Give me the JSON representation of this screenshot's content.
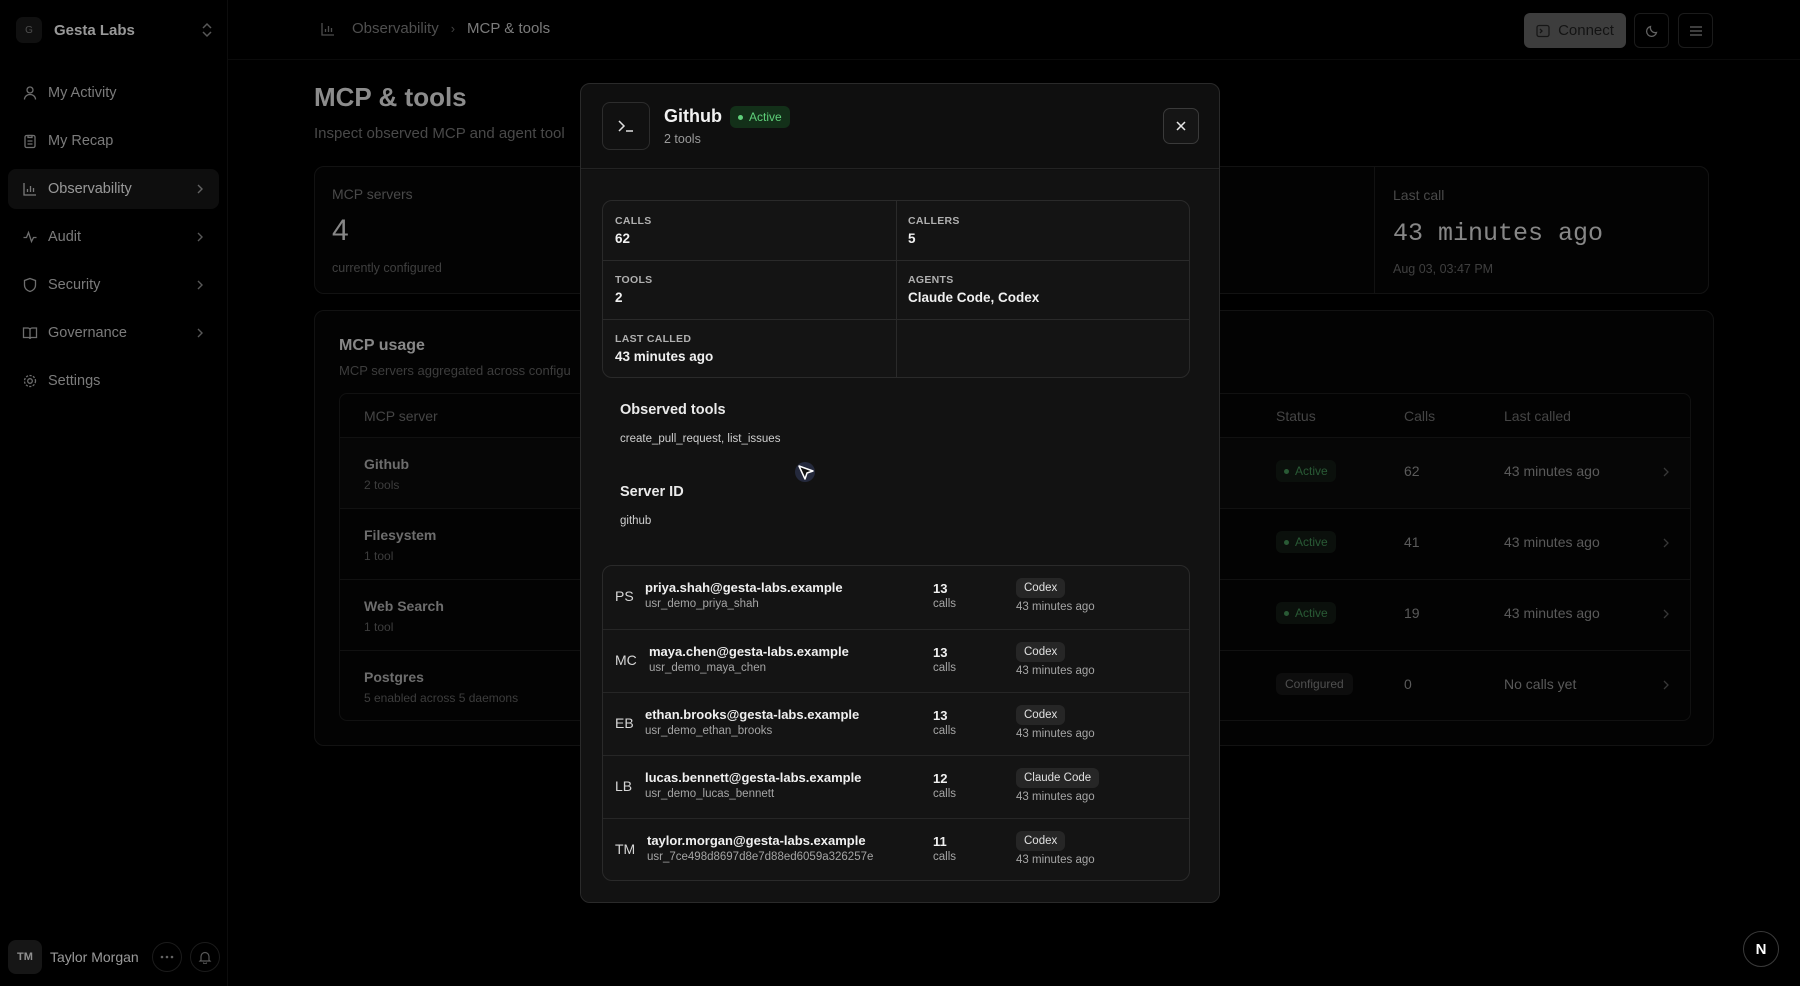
{
  "sidebar": {
    "org_initial": "G",
    "org_name": "Gesta Labs",
    "items": [
      {
        "label": "My Activity",
        "icon": "user-icon"
      },
      {
        "label": "My Recap",
        "icon": "clipboard-icon"
      },
      {
        "label": "Observability",
        "icon": "bar-chart-icon"
      },
      {
        "label": "Audit",
        "icon": "activity-icon"
      },
      {
        "label": "Security",
        "icon": "shield-icon"
      },
      {
        "label": "Governance",
        "icon": "book-icon"
      },
      {
        "label": "Settings",
        "icon": "gear-icon"
      }
    ],
    "user_initials": "TM",
    "user_name": "Taylor Morgan"
  },
  "topbar": {
    "breadcrumb_parent": "Observability",
    "breadcrumb_current": "MCP & tools",
    "connect_label": "Connect"
  },
  "page": {
    "title": "MCP & tools",
    "subtitle": "Inspect observed MCP and agent tool",
    "stats": [
      {
        "label": "MCP servers",
        "value": "4",
        "note": "currently configured"
      },
      {
        "label": "Last call",
        "value": "43 minutes ago",
        "note": "Aug 03, 03:47 PM"
      }
    ],
    "usage": {
      "title": "MCP usage",
      "subtitle": "MCP servers aggregated across configu",
      "headers": {
        "server": "MCP server",
        "status": "Status",
        "calls": "Calls",
        "last_called": "Last called"
      },
      "rows": [
        {
          "name": "Github",
          "sub": "2 tools",
          "status": "Active",
          "calls": "62",
          "last": "43 minutes ago"
        },
        {
          "name": "Filesystem",
          "sub": "1 tool",
          "status": "Active",
          "calls": "41",
          "last": "43 minutes ago"
        },
        {
          "name": "Web Search",
          "sub": "1 tool",
          "status": "Active",
          "calls": "19",
          "last": "43 minutes ago"
        },
        {
          "name": "Postgres",
          "sub": "5 enabled across 5 daemons",
          "status": "Configured",
          "calls": "0",
          "last": "No calls yet"
        }
      ]
    }
  },
  "modal": {
    "title": "Github",
    "status": "Active",
    "subtitle": "2 tools",
    "stats": {
      "calls_label": "CALLS",
      "calls": "62",
      "callers_label": "CALLERS",
      "callers": "5",
      "tools_label": "TOOLS",
      "tools": "2",
      "agents_label": "AGENTS",
      "agents": "Claude Code, Codex",
      "last_called_label": "LAST CALLED",
      "last_called": "43 minutes ago"
    },
    "observed_tools_title": "Observed tools",
    "observed_tools": "create_pull_request, list_issues",
    "server_id_title": "Server ID",
    "server_id": "github",
    "callers": [
      {
        "initials": "PS",
        "email": "priya.shah@gesta-labs.example",
        "id": "usr_demo_priya_shah",
        "calls": "13",
        "calls_label": "calls",
        "agent": "Codex",
        "time": "43 minutes ago"
      },
      {
        "initials": "MC",
        "email": "maya.chen@gesta-labs.example",
        "id": "usr_demo_maya_chen",
        "calls": "13",
        "calls_label": "calls",
        "agent": "Codex",
        "time": "43 minutes ago"
      },
      {
        "initials": "EB",
        "email": "ethan.brooks@gesta-labs.example",
        "id": "usr_demo_ethan_brooks",
        "calls": "13",
        "calls_label": "calls",
        "agent": "Codex",
        "time": "43 minutes ago"
      },
      {
        "initials": "LB",
        "email": "lucas.bennett@gesta-labs.example",
        "id": "usr_demo_lucas_bennett",
        "calls": "12",
        "calls_label": "calls",
        "agent": "Claude Code",
        "time": "43 minutes ago"
      },
      {
        "initials": "TM",
        "email": "taylor.morgan@gesta-labs.example",
        "id": "usr_7ce498d8697d8e7d88ed6059a326257e",
        "calls": "11",
        "calls_label": "calls",
        "agent": "Codex",
        "time": "43 minutes ago"
      }
    ]
  },
  "corner_badge": "N",
  "colors": {
    "active_green": "#5fd07a",
    "active_bg": "#133019"
  }
}
